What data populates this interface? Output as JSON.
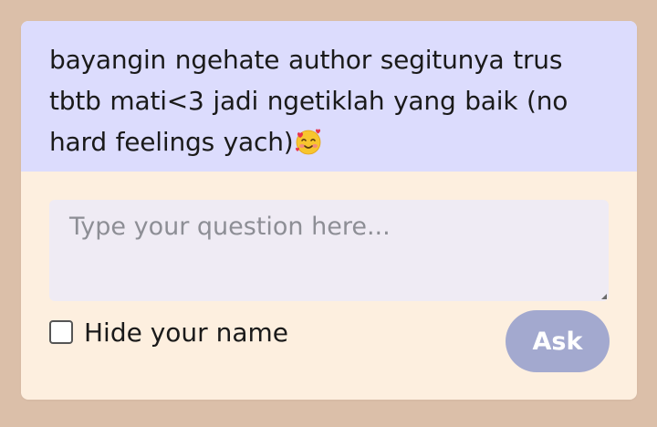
{
  "prompt": {
    "text": "bayangin ngehate author segitunya trus tbtb mati<3 jadi ngetiklah yang baik (no hard feelings yach)",
    "emoji_icon": "smiling-face-with-hearts-icon"
  },
  "question": {
    "placeholder": "Type your question here...",
    "value": ""
  },
  "hide_name": {
    "label": "Hide your name",
    "checked": false
  },
  "ask_button": {
    "label": "Ask"
  },
  "colors": {
    "background": "#dbbfa9",
    "prompt_bg": "#dcdcfd",
    "card_bg": "#fdefdf",
    "input_bg": "#efebf4",
    "button_bg": "#a3a9cf"
  }
}
